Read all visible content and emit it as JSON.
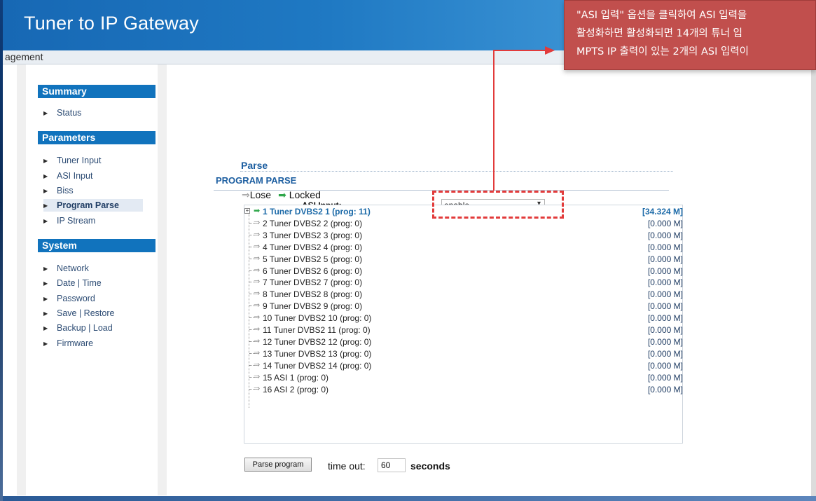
{
  "app": {
    "title": "Tuner to IP Gateway",
    "subtitle": "agement"
  },
  "sidebar": {
    "sections": [
      {
        "title": "Summary",
        "items": [
          {
            "label": "Status"
          }
        ]
      },
      {
        "title": "Parameters",
        "items": [
          {
            "label": "Tuner Input"
          },
          {
            "label": "ASI Input"
          },
          {
            "label": "Biss"
          },
          {
            "label": "Program Parse",
            "active": true
          },
          {
            "label": "IP Stream"
          }
        ]
      },
      {
        "title": "System",
        "items": [
          {
            "label": "Network"
          },
          {
            "label": "Date | Time"
          },
          {
            "label": "Password"
          },
          {
            "label": "Save | Restore"
          },
          {
            "label": "Backup | Load"
          },
          {
            "label": "Firmware"
          }
        ]
      }
    ]
  },
  "main": {
    "page_title": "PROGRAM PARSE",
    "asi_input": {
      "label": "ASI Input:",
      "value": "enable"
    },
    "parse": {
      "heading": "Parse",
      "legend": {
        "lose": "Lose",
        "locked": "Locked"
      },
      "rows": [
        {
          "label": "1 Tuner DVBS2 1 (prog: 11)",
          "rate": "[34.324 M]",
          "locked": true
        },
        {
          "label": "2 Tuner DVBS2 2 (prog: 0)",
          "rate": "[0.000 M]"
        },
        {
          "label": "3 Tuner DVBS2 3 (prog: 0)",
          "rate": "[0.000 M]"
        },
        {
          "label": "4 Tuner DVBS2 4 (prog: 0)",
          "rate": "[0.000 M]"
        },
        {
          "label": "5 Tuner DVBS2 5 (prog: 0)",
          "rate": "[0.000 M]"
        },
        {
          "label": "6 Tuner DVBS2 6 (prog: 0)",
          "rate": "[0.000 M]"
        },
        {
          "label": "7 Tuner DVBS2 7 (prog: 0)",
          "rate": "[0.000 M]"
        },
        {
          "label": "8 Tuner DVBS2 8 (prog: 0)",
          "rate": "[0.000 M]"
        },
        {
          "label": "9 Tuner DVBS2 9 (prog: 0)",
          "rate": "[0.000 M]"
        },
        {
          "label": "10 Tuner DVBS2 10 (prog: 0)",
          "rate": "[0.000 M]"
        },
        {
          "label": "11 Tuner DVBS2 11 (prog: 0)",
          "rate": "[0.000 M]"
        },
        {
          "label": "12 Tuner DVBS2 12 (prog: 0)",
          "rate": "[0.000 M]"
        },
        {
          "label": "13 Tuner DVBS2 13 (prog: 0)",
          "rate": "[0.000 M]"
        },
        {
          "label": "14 Tuner DVBS2 14 (prog: 0)",
          "rate": "[0.000 M]"
        },
        {
          "label": "15 ASI 1 (prog: 0)",
          "rate": "[0.000 M]"
        },
        {
          "label": "16 ASI 2 (prog: 0)",
          "rate": "[0.000 M]"
        }
      ]
    },
    "parse_button": "Parse program",
    "timeout": {
      "label": "time out:",
      "value": "60",
      "unit": "seconds"
    }
  },
  "callout": {
    "lines": [
      "\"ASI 입력\" 옵션을 클릭하여 ASI 입력을",
      "활성화하면 활성화되면 14개의 튜너 입",
      "MPTS IP 출력이 있는 2개의 ASI 입력이"
    ]
  },
  "colors": {
    "header_blue": "#1f79c3",
    "section_blue": "#1173bd",
    "callout_red": "#c14f4d",
    "locked_green": "#2fa64a"
  }
}
